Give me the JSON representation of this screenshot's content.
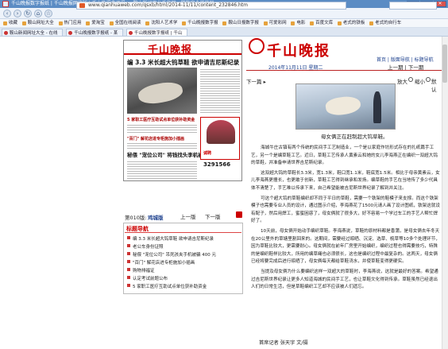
{
  "window": {
    "title": "千山晚报数字报纸 | 千山晚报网络版 | 千山晚报电子报 — 鞍山新闻平台千华网 - 猎豹安全浏览器",
    "controls": [
      "─",
      "□",
      "✕"
    ]
  },
  "nav": {
    "back": "‹",
    "forward": "›",
    "refresh": "↻",
    "home": "⌂",
    "star": "☆",
    "url": "www.qianhuaweb.com/qsxb/html/2014-11/11/content_232846.htm"
  },
  "favorites": [
    "收藏",
    "鞍山网址大全",
    "热门应用",
    "爱淘宝",
    "全国在线阅读",
    "沈阳人艺术学",
    "千山晚报数字报",
    "鞍山日报数字报",
    "可爱彩网",
    "电影",
    "百度文库",
    "老式的铁板",
    "老式的自行车"
  ],
  "tabs": [
    {
      "label": "鞍山新闻网址大全 - 在线",
      "active": false
    },
    {
      "label": "千山晚报数字报纸 - 某",
      "active": false
    },
    {
      "label": "千山晚报数字报纸 | 千山",
      "active": true
    }
  ],
  "paper": {
    "logo": "千山晚报",
    "headline": "编 3.3 米长超大钨草鞋 欲申请吉尼斯纪录",
    "sub1": "5 家职工医疗互助试点单位获补助资金",
    "sub2": "\"百门\" 解花店进专柜施加小插画",
    "big_headline": "秘偎 \"宠位公司\" 将钱找头李机被骗 400 元",
    "ad_title": "诚聘",
    "ad_phone": "3291566"
  },
  "section": {
    "label": "第010版:",
    "name": "鸡城版",
    "prev": "上一版",
    "next": "下一版"
  },
  "headlines": {
    "title": "标题导航",
    "items": [
      "编 3.3 米长超大钨草鞋 欲申请吉尼斯纪录",
      "老公车身份证照",
      "秘偎 \"宠位公司\" 吊死孩夹手机被骗 400 元",
      "\"百门\" 解花店进专柜施加小插画",
      "购物排福证",
      "认定考试前题公布",
      "5 家职工医疗互助试点单位获补助资金"
    ]
  },
  "right": {
    "logo": "千山晚报",
    "top_links": "首页 | 版面导航 | 标题导航",
    "date": "2014年11月11日 星期二",
    "prev_article": "上一期",
    "next_article_top": "下一期",
    "next_article": "下一篇 ▸",
    "font_label": "放大 ◎ 缩小 ◎ 默认 ◎",
    "font_options": [
      "放大",
      "缩小",
      "默认"
    ],
    "font_selected": "默认",
    "photo_caption": "母女俩正在赶制超大钨草鞋。"
  },
  "article": {
    "paragraphs": [
      "海城牛庄古镇有两个传统的民间手工艺制造业，一个是以家庭作坊形式存在的扎纸篇手工艺，另一个是编草鞋工艺。近日，草鞋工艺传承人黄素云和她的女儿李海燕正在编织一双超大钨的草鞋，并准备申请世界吉尼斯纪录。",
      "这双超大钨的草鞋长3.3米，宽1.3米，鞋口宽1.1米，鞋底宽1.5米。相比于母亲黄素云，女儿李海燕更擅长，也更敢于创新，草鞋工艺得到继承和发扬。编草鞋的手艺在当地传了多少代具体不清楚了，手艺难以传承下来，自己希望能被吉尼斯世界纪录了解到并关注。",
      "可这个超大钨的草鞋编织却不同于平日的草鞋，需要一个铁架的鞋模子来支撑。而这个铁架模子也需要专业人员的设计，通过图示介绍，李海燕花了1500元请人画了设计图纸，铁架这就设有配子，然后用焊工，蜜蜜困惑了，母女俩就了很多大，好不容易一个学过车工的手艺人帮忙焊好了。",
      "10天前，母女俩开始动手编织草鞋。李海燕说，草鞋的原材料都是香蒲，是母女俩去年冬天在20公里外的草塘里割回来的。这期间，需要经过晾晒、沉淀、选草、梳草等10多个处理环节，因为草鞋比较大，更需要耐心。母女俩就在前年厂房里开始编织，编织过程也得需要技巧，特殊的是编织鞋样比较大，所用的编草绳也必须很长，这也是编织过程中最复杂的。这两天，母女俩已经将要完成后进行晾晒了，母女俩每天都给草鞋浇水，并使草鞋变得更硬实。",
      "当提及母女俩为什么要编织这样一双超大的草鞋时，李海燕说，这就是最好的答案。希望通过吉尼斯世界纪录让更多人知道海城的民间手工艺，也让草鞋文化得到传承。草鞋虽然已经退出人们的日常生活，但是草鞋编织工艺却不应该被人们遗忘。"
    ],
    "byline": "首席记者 张天宇 文/摄"
  }
}
